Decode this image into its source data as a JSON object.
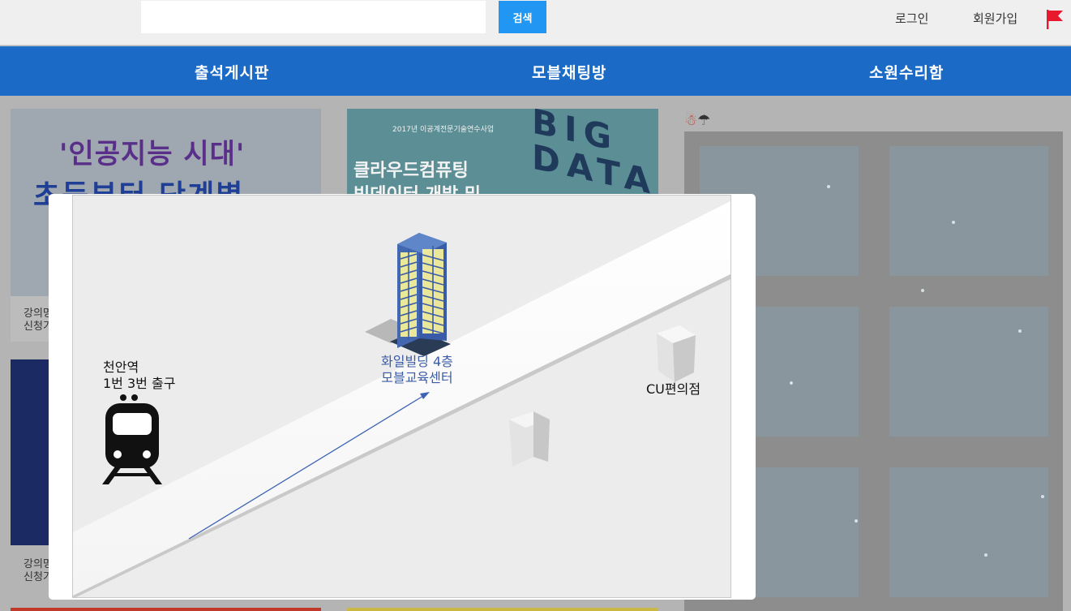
{
  "header": {
    "search": {
      "placeholder": "",
      "value": "",
      "button_label": "검색"
    },
    "links": [
      "로그인",
      "회원가입"
    ],
    "flag_color": "#e8192c"
  },
  "nav": {
    "items": [
      "출석게시판",
      "모블채팅방",
      "소원수리함"
    ],
    "background": "#1a6ac6"
  },
  "background_cards": {
    "ai_banner": {
      "line1": "'인공지능 시대'",
      "line2": "초등부터 단계별",
      "caption": [
        "강의명",
        "신청기"
      ]
    },
    "cloud_banner": {
      "tag": "2017년 이공계전문기술연수사업",
      "line1": "클라우드컴퓨팅",
      "line2": "빅데이터 개발 및",
      "art_text": "BIG DATA"
    },
    "second_row_caption": [
      "강의명",
      "신청기"
    ]
  },
  "weather": {
    "icons": [
      "snowman-icon",
      "umbrella-icon"
    ]
  },
  "map": {
    "station": {
      "line1": "천안역",
      "line2": "1번 3번 출구"
    },
    "building": {
      "line1": "화일빌딩 4층",
      "line2": "모블교육센터"
    },
    "store": "CU편의점",
    "label_color_building": "#3a5ba8",
    "arrow_color": "#3d63b4"
  }
}
